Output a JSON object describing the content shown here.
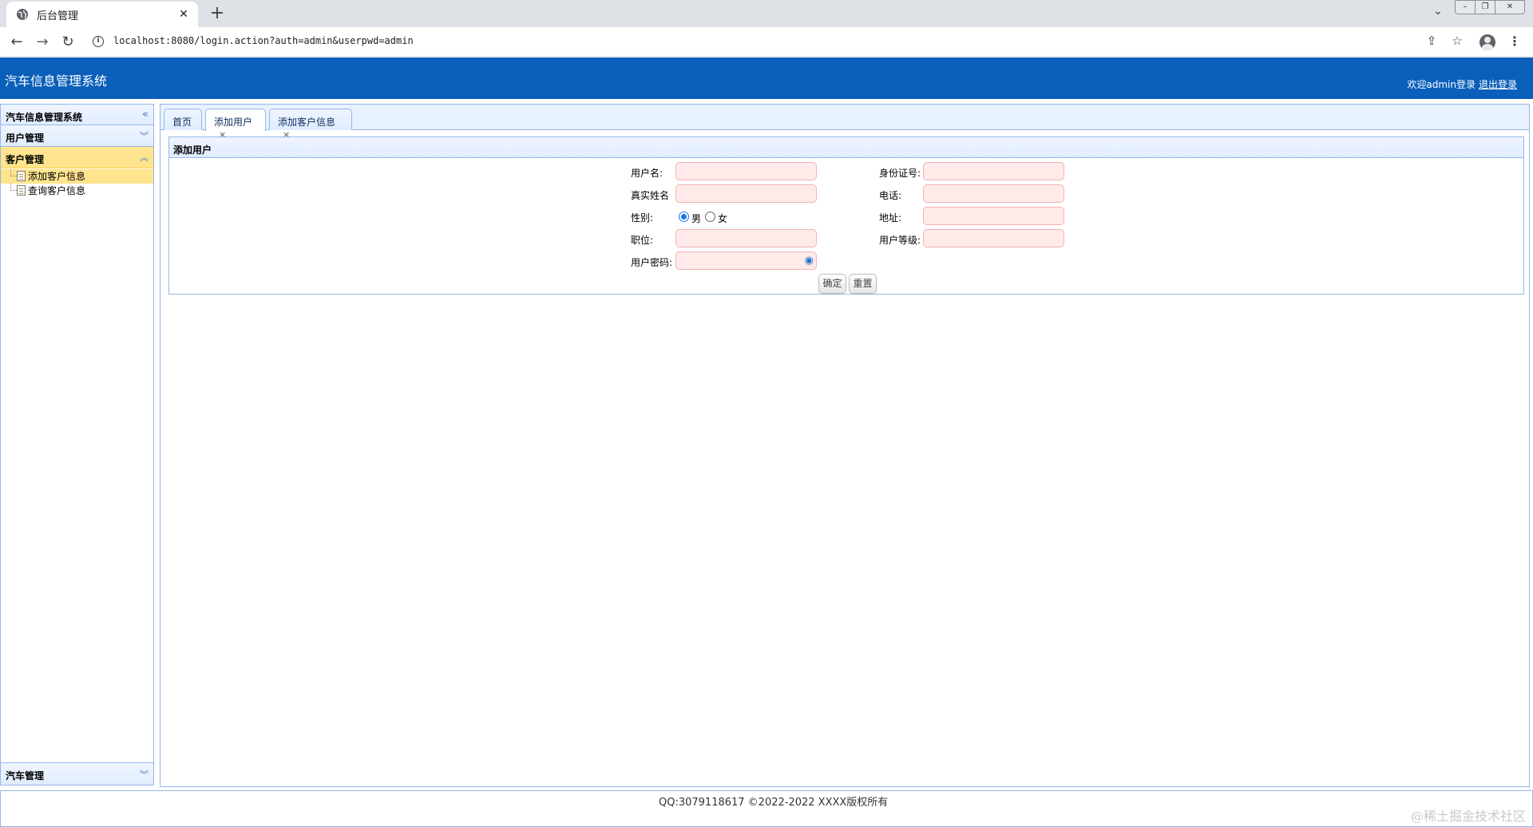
{
  "browser": {
    "tab_title": "后台管理",
    "url": "localhost:8080/login.action?auth=admin&userpwd=admin"
  },
  "header": {
    "app_title": "汽车信息管理系统",
    "welcome": "欢迎admin登录",
    "logout": "退出登录"
  },
  "sidebar": {
    "title": "汽车信息管理系统",
    "sections": [
      {
        "label": "用户管理"
      },
      {
        "label": "客户管理",
        "items": [
          "添加客户信息",
          "查询客户信息"
        ]
      },
      {
        "label": "汽车管理"
      }
    ]
  },
  "tabs": [
    {
      "label": "首页"
    },
    {
      "label": "添加用户",
      "active": true
    },
    {
      "label": "添加客户信息"
    }
  ],
  "form": {
    "title": "添加用户",
    "username_label": "用户名:",
    "idcard_label": "身份证号:",
    "realname_label": "真实姓名",
    "phone_label": "电话:",
    "gender_label": "性别:",
    "gender_options": [
      "男",
      "女"
    ],
    "gender_selected": "男",
    "address_label": "地址:",
    "position_label": "职位:",
    "level_label": "用户等级:",
    "password_label": "用户密码:",
    "submit": "确定",
    "reset": "重置"
  },
  "footer": {
    "text": "QQ:3079118617 ©2022-2022 XXXX版权所有",
    "watermark": "@稀土掘金技术社区"
  },
  "colors": {
    "header_bg": "#0a5fba",
    "accordion_selected": "#ffe48d",
    "input_bg": "#ffeaea",
    "border": "#95b8e7"
  }
}
